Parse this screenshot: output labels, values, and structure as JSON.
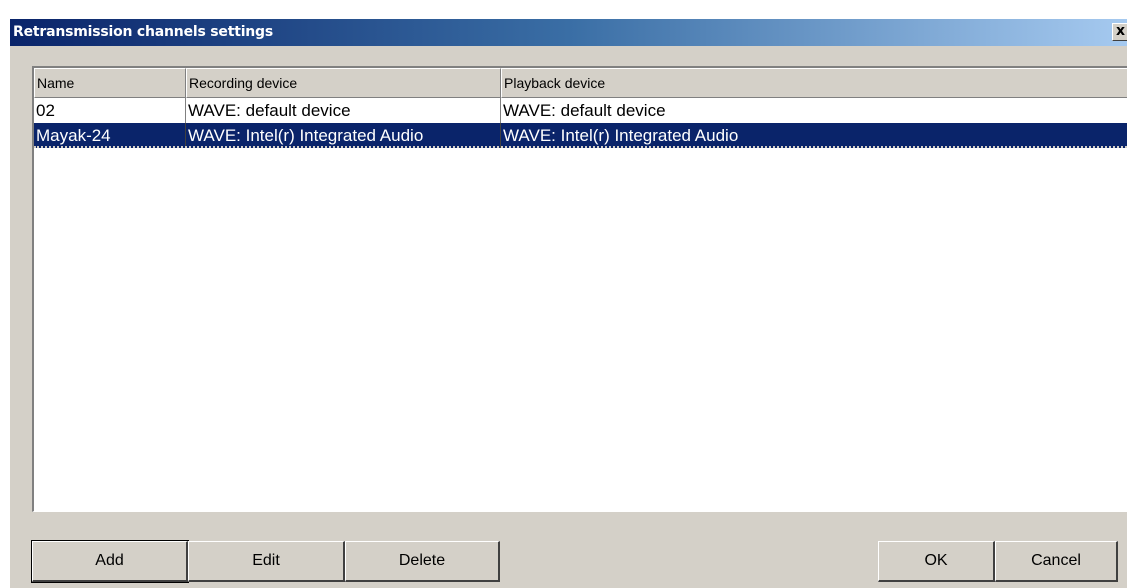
{
  "window": {
    "title": "Retransmission channels settings",
    "close_glyph": "x"
  },
  "table": {
    "columns": [
      "Name",
      "Recording device",
      "Playback device"
    ],
    "rows": [
      {
        "name": "02",
        "recording": "WAVE: default device",
        "playback": "WAVE: default device",
        "selected": false
      },
      {
        "name": "Mayak-24",
        "recording": "WAVE: Intel(r) Integrated Audio",
        "playback": "WAVE: Intel(r) Integrated Audio",
        "selected": true
      }
    ]
  },
  "buttons": {
    "add": "Add",
    "edit": "Edit",
    "delete": "Delete",
    "ok": "OK",
    "cancel": "Cancel"
  },
  "colors": {
    "title_gradient_start": "#0a246a",
    "title_gradient_end": "#a6caf0",
    "selection": "#0a246a",
    "face": "#d4d0c8"
  }
}
